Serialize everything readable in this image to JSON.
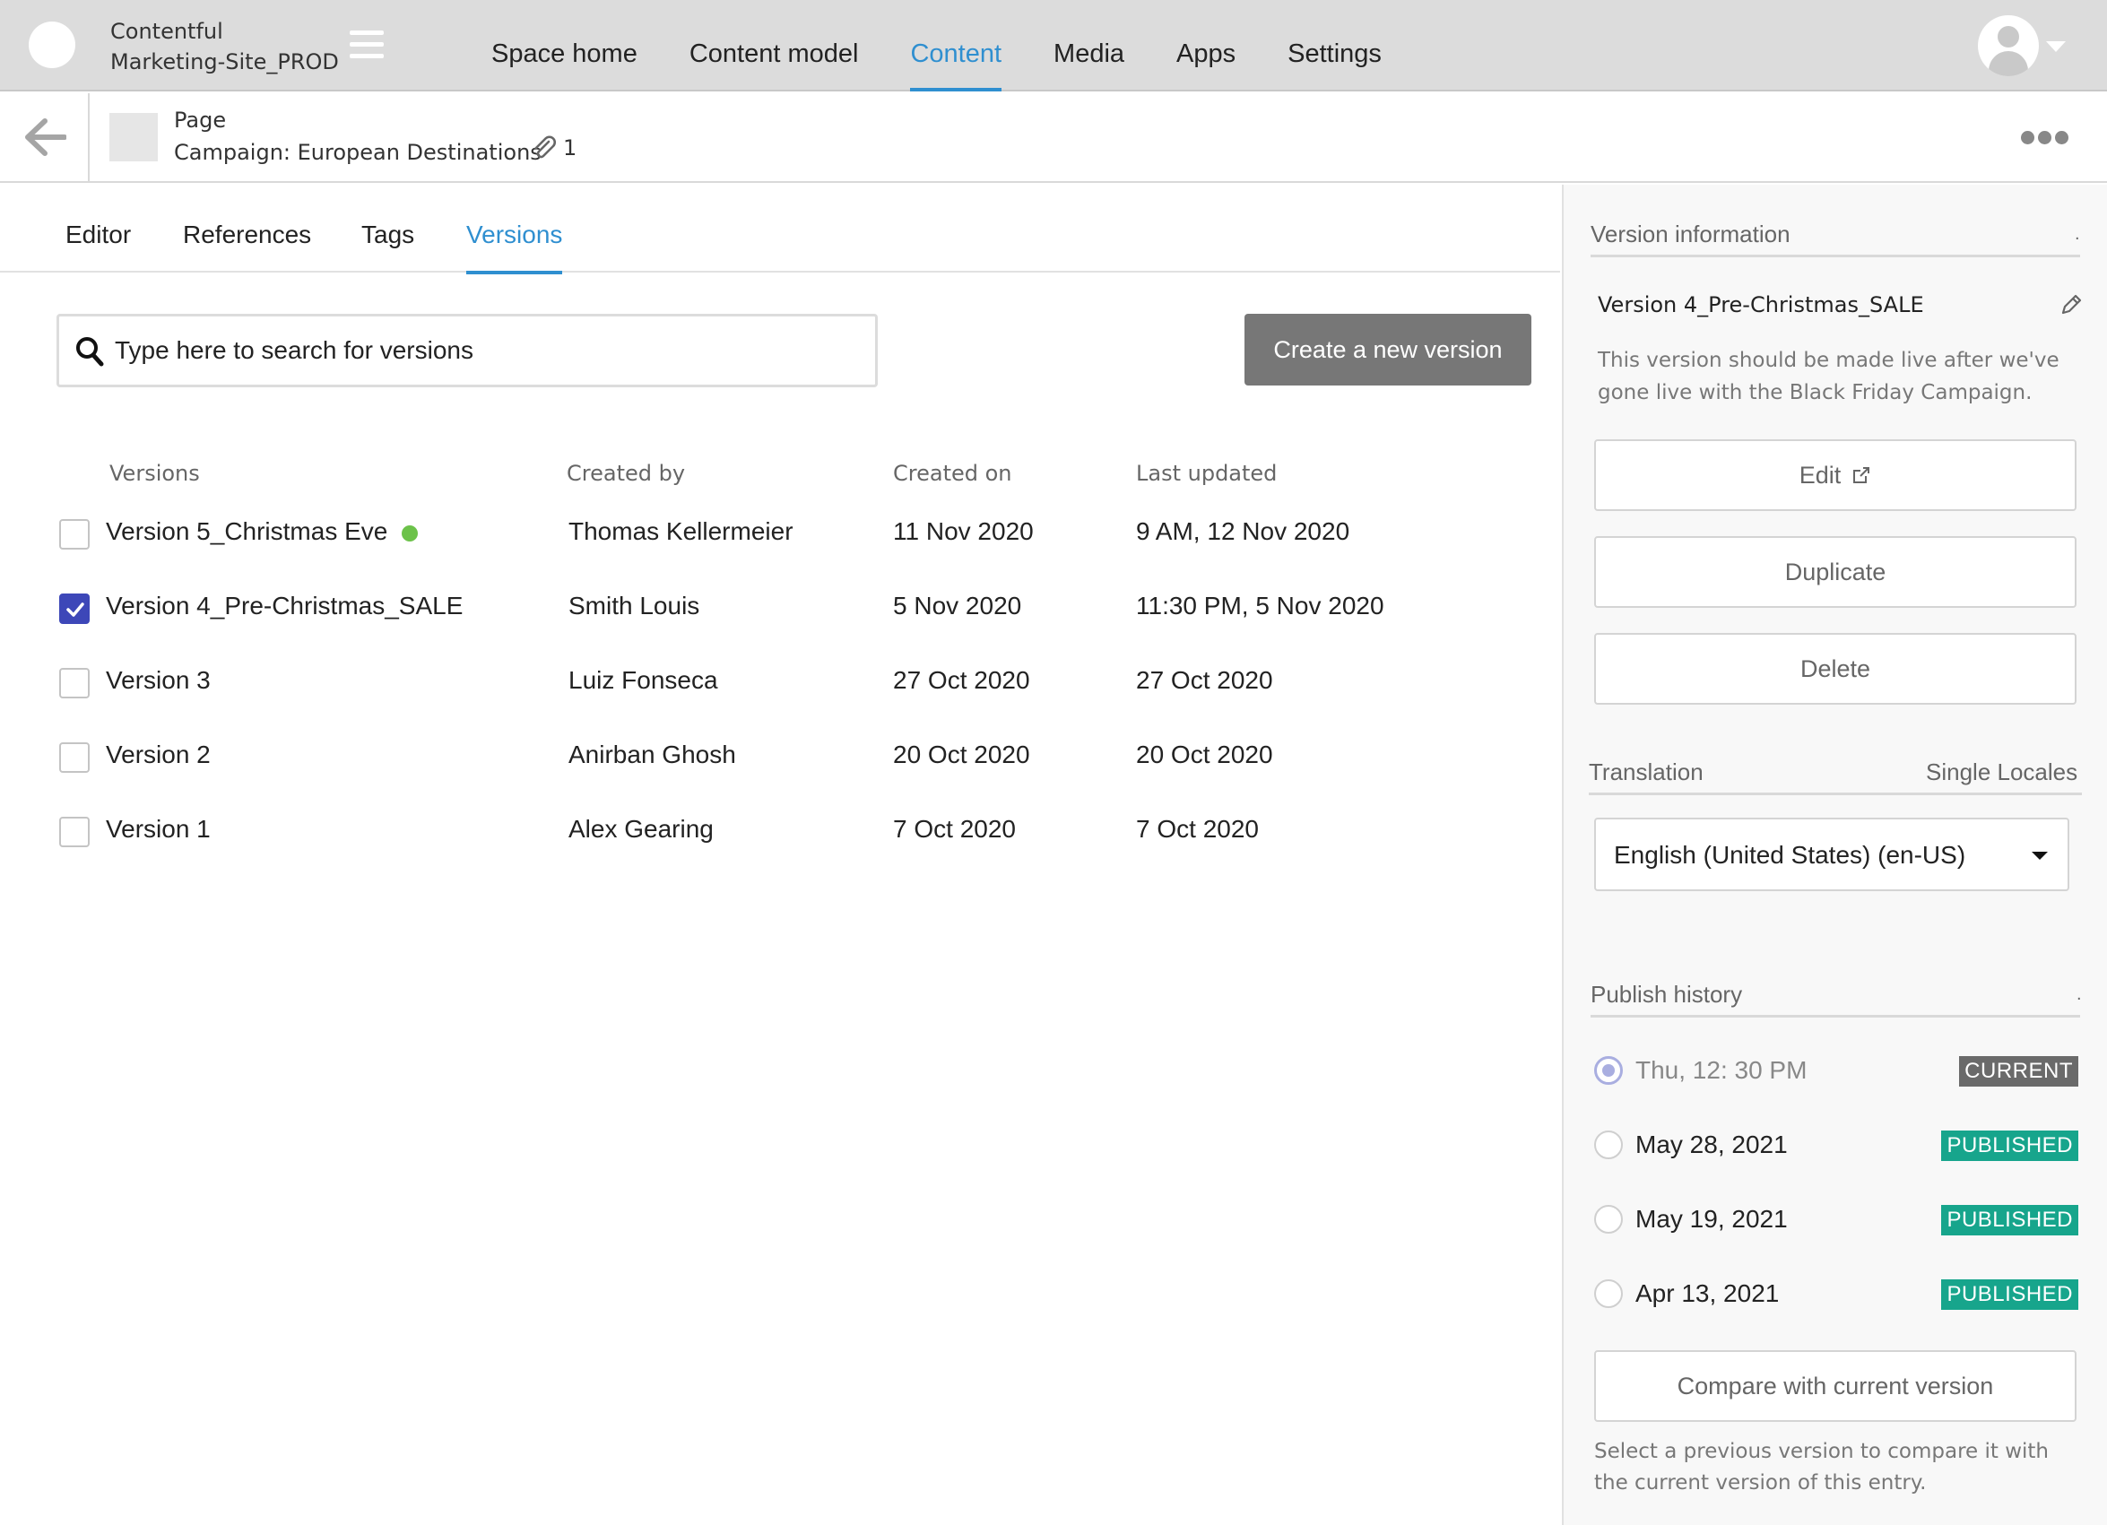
{
  "topbar": {
    "org_name": "Contentful",
    "space_name": "Marketing-Site_PROD",
    "nav": [
      "Space home",
      "Content model",
      "Content",
      "Media",
      "Apps",
      "Settings"
    ]
  },
  "entry": {
    "type": "Page",
    "title": "Campaign: European Destinations",
    "attachments": "1"
  },
  "tabs": [
    "Editor",
    "References",
    "Tags",
    "Versions"
  ],
  "search": {
    "placeholder": "Type here to search for versions"
  },
  "create_button": "Create a new version",
  "table": {
    "headers": [
      "Versions",
      "Created by",
      "Created on",
      "Last updated"
    ],
    "rows": [
      {
        "name": "Version 5_Christmas Eve",
        "created_by": "Thomas Kellermeier",
        "created_on": "11 Nov 2020",
        "updated": "9 AM, 12 Nov 2020",
        "checked": false,
        "live": true
      },
      {
        "name": "Version 4_Pre-Christmas_SALE",
        "created_by": "Smith Louis",
        "created_on": "5 Nov 2020",
        "updated": "11:30 PM, 5 Nov 2020",
        "checked": true,
        "live": false
      },
      {
        "name": "Version 3",
        "created_by": "Luiz Fonseca",
        "created_on": "27 Oct 2020",
        "updated": "27 Oct 2020",
        "checked": false,
        "live": false
      },
      {
        "name": "Version 2",
        "created_by": "Anirban Ghosh",
        "created_on": "20 Oct 2020",
        "updated": "20 Oct 2020",
        "checked": false,
        "live": false
      },
      {
        "name": "Version 1",
        "created_by": "Alex Gearing",
        "created_on": "7 Oct 2020",
        "updated": "7 Oct 2020",
        "checked": false,
        "live": false
      }
    ]
  },
  "sidebar": {
    "version_info_title": "Version information",
    "version_name": "Version 4_Pre-Christmas_SALE",
    "version_desc": "This version should be made live after we've gone live with the Black Friday Campaign.",
    "edit_label": "Edit",
    "duplicate_label": "Duplicate",
    "delete_label": "Delete",
    "translation_title": "Translation",
    "translation_mode": "Single Locales",
    "locale_selected": "English (United States) (en-US)",
    "publish_history_title": "Publish history",
    "history": [
      {
        "date": "Thu, 12: 30 PM",
        "badge": "CURRENT",
        "selected": true
      },
      {
        "date": "May 28, 2021",
        "badge": "PUBLISHED",
        "selected": false
      },
      {
        "date": "May 19, 2021",
        "badge": "PUBLISHED",
        "selected": false
      },
      {
        "date": "Apr 13, 2021",
        "badge": "PUBLISHED",
        "selected": false
      }
    ],
    "compare_label": "Compare with current version",
    "compare_note": "Select a previous version to compare it with the current version of this entry."
  },
  "colors": {
    "accent": "#2f8fd0",
    "checkbox": "#3d47b8",
    "published": "#17a58c",
    "live": "#6cc24a"
  }
}
